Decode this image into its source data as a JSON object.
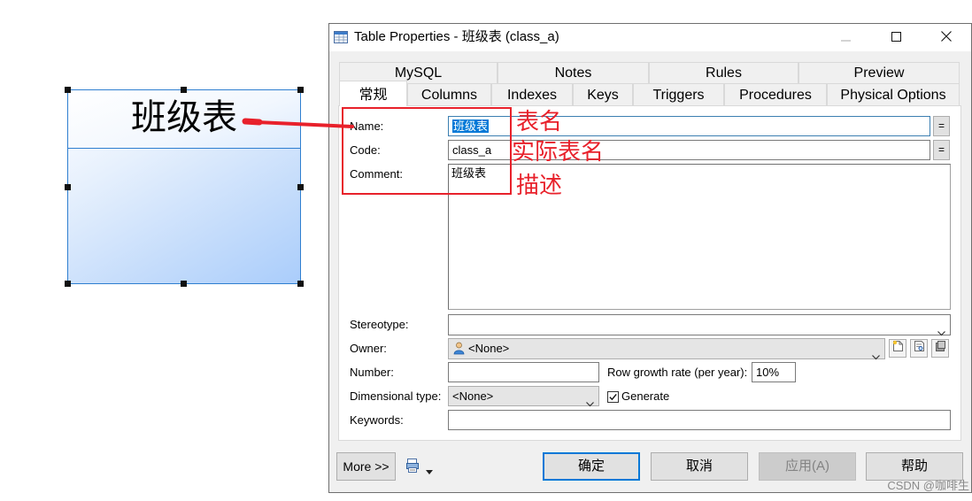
{
  "diagram": {
    "entity_title": "班级表"
  },
  "annotations": {
    "name_note": "表名",
    "code_note": "实际表名",
    "comment_note": "描述"
  },
  "window": {
    "title": "Table Properties - 班级表 (class_a)",
    "icon": "table-icon",
    "controls": [
      "minimize-icon",
      "maximize-icon",
      "close-icon"
    ]
  },
  "tabs": {
    "row1": [
      "MySQL",
      "Notes",
      "Rules",
      "Preview"
    ],
    "row2": [
      "常规",
      "Columns",
      "Indexes",
      "Keys",
      "Triggers",
      "Procedures",
      "Physical Options"
    ],
    "active_row2_index": 0
  },
  "form": {
    "eq_button": "=",
    "name": {
      "label": "Name:",
      "value": "班级表"
    },
    "code": {
      "label": "Code:",
      "value": "class_a"
    },
    "comment": {
      "label": "Comment:",
      "value": "班级表"
    },
    "stereotype": {
      "label": "Stereotype:",
      "value": ""
    },
    "owner": {
      "label": "Owner:",
      "value": "<None>",
      "icon": "user-icon",
      "buttons": [
        "new-icon",
        "properties-icon",
        "select-icon"
      ]
    },
    "number": {
      "label": "Number:",
      "value": ""
    },
    "row_growth": {
      "label": "Row growth rate (per year):",
      "value": "10%"
    },
    "dimensional_type": {
      "label": "Dimensional type:",
      "value": "<None>"
    },
    "generate": {
      "label": "Generate",
      "checked": true
    },
    "keywords": {
      "label": "Keywords:",
      "value": ""
    }
  },
  "footer": {
    "more": "More >>",
    "print_icon": "print-icon",
    "ok": "确定",
    "cancel": "取消",
    "apply": "应用(A)",
    "apply_enabled": false,
    "help": "帮助"
  },
  "colors": {
    "annotation": "#e8212b",
    "selection": "#0078d7",
    "entity_border": "#2f7fd0",
    "default_button_border": "#0078d7"
  },
  "watermark": "CSDN @咖啡生"
}
